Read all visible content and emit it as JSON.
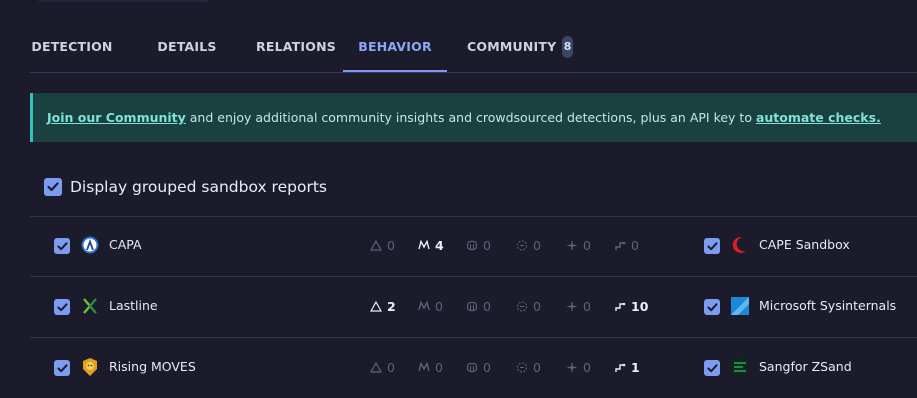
{
  "tabs": [
    {
      "label": "DETECTION"
    },
    {
      "label": "DETAILS"
    },
    {
      "label": "RELATIONS"
    },
    {
      "label": "BEHAVIOR"
    },
    {
      "label": "COMMUNITY",
      "badge": "8"
    }
  ],
  "active_tab": "BEHAVIOR",
  "banner": {
    "link1": "Join our Community",
    "text": " and enjoy additional community insights and crowdsourced detections, plus an API key to ",
    "link2": "automate checks."
  },
  "grouped_label": "Display grouped sandbox reports",
  "rows": [
    {
      "name": "CAPA",
      "metrics": [
        "0",
        "4",
        "0",
        "0",
        "0",
        "0"
      ],
      "right_name": "CAPE Sandbox"
    },
    {
      "name": "Lastline",
      "metrics": [
        "2",
        "0",
        "0",
        "0",
        "0",
        "10"
      ],
      "right_name": "Microsoft Sysinternals"
    },
    {
      "name": "Rising MOVES",
      "metrics": [
        "0",
        "0",
        "0",
        "0",
        "0",
        "1"
      ],
      "right_name": "Sangfor ZSand"
    }
  ],
  "colors": {
    "accent": "#7b9cf0",
    "banner_bg": "#1a4040",
    "banner_border": "#2ec2b8",
    "page_bg": "#1c1b2b"
  }
}
